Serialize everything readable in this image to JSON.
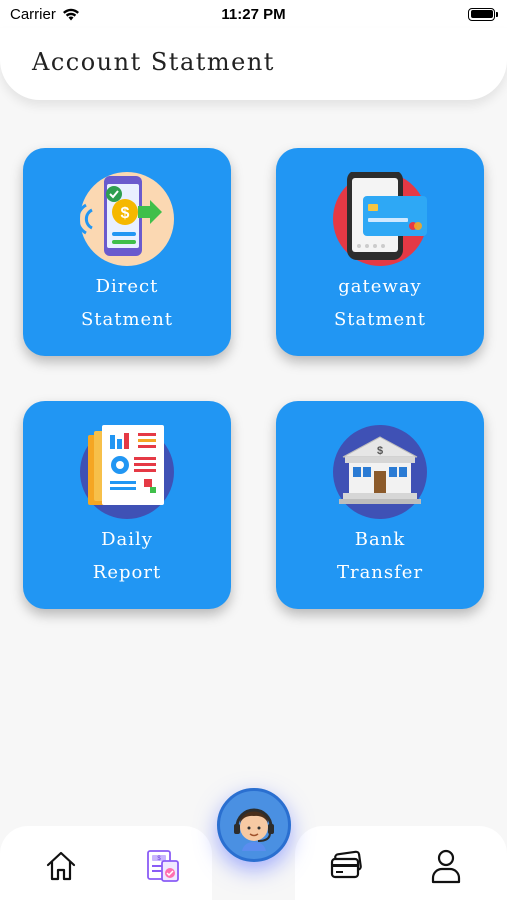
{
  "status_bar": {
    "carrier": "Carrier",
    "time": "11:27 PM"
  },
  "header": {
    "title": "Account Statment"
  },
  "tiles": [
    {
      "line1": "Direct",
      "line2": "Statment",
      "icon": "phone-payment-icon"
    },
    {
      "line1": "gateway",
      "line2": "Statment",
      "icon": "card-phone-icon"
    },
    {
      "line1": "Daily",
      "line2": "Report",
      "icon": "report-document-icon"
    },
    {
      "line1": "Bank",
      "line2": "Transfer",
      "icon": "bank-building-icon"
    }
  ],
  "bottom_nav": {
    "items": [
      "home-icon",
      "statement-icon",
      "support-agent-icon",
      "cards-icon",
      "profile-icon"
    ]
  },
  "colors": {
    "tile": "#2196f3",
    "background": "#f7f7f7",
    "fab": "#4a90e2"
  }
}
